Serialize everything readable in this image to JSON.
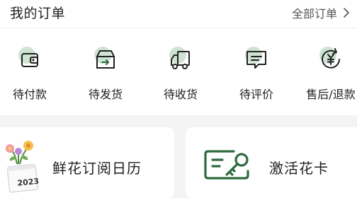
{
  "orders": {
    "title": "我的订单",
    "all_link": "全部订单",
    "statuses": [
      {
        "label": "待付款",
        "icon": "wallet-icon"
      },
      {
        "label": "待发货",
        "icon": "box-icon"
      },
      {
        "label": "待收货",
        "icon": "truck-icon"
      },
      {
        "label": "待评价",
        "icon": "comment-icon"
      },
      {
        "label": "售后/退款",
        "icon": "refund-icon"
      }
    ]
  },
  "cards": [
    {
      "label": "鲜花订阅日历",
      "icon": "flower-calendar-icon",
      "calendar_text": "2023"
    },
    {
      "label": "激活花卡",
      "icon": "key-card-icon"
    }
  ],
  "colors": {
    "accent_green": "#2d6a3e",
    "icon_circle": "#cfe3d2",
    "background": "#f4f4f4"
  }
}
